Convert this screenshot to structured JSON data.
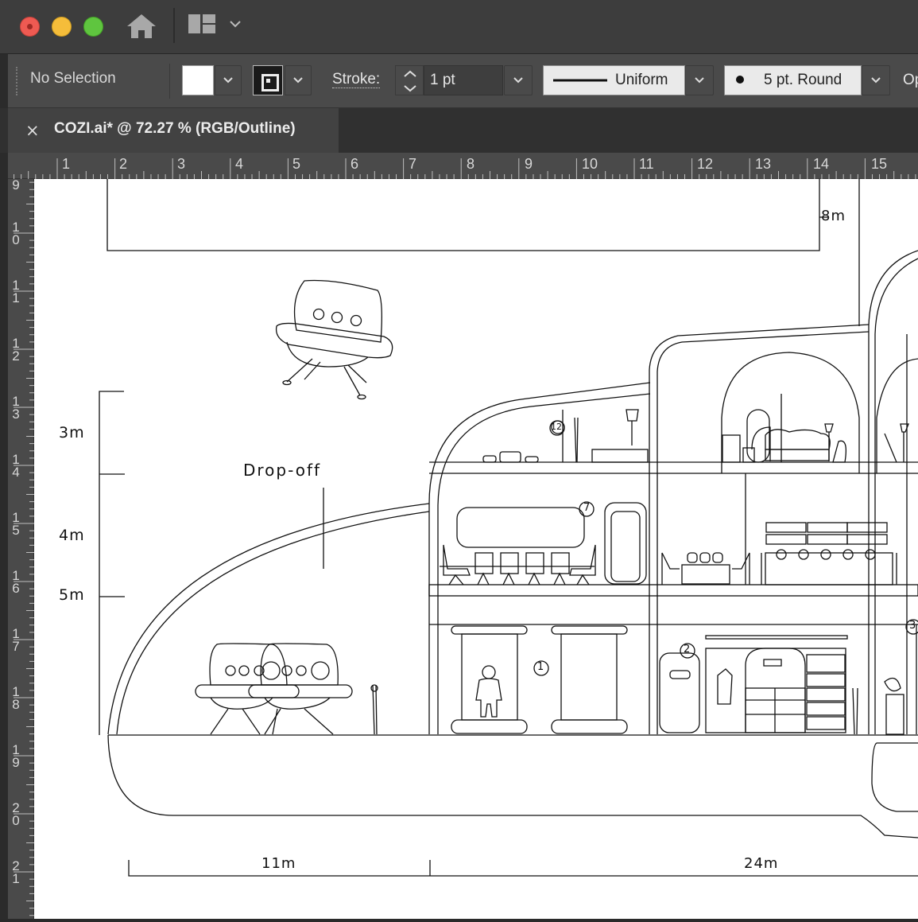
{
  "window": {
    "controls": [
      "close-button",
      "minimize-button",
      "zoom-button"
    ]
  },
  "titlebar": {
    "icons": [
      "home-icon",
      "workspace-layout-icon",
      "chevron-down-icon"
    ]
  },
  "control_bar": {
    "selection_status": "No Selection",
    "stroke_label": "Stroke:",
    "stroke_weight": "1 pt",
    "variable_width_profile": "Uniform",
    "brush_definition": "5 pt. Round",
    "truncated_label": "Op"
  },
  "document_tab": {
    "close_glyph": "×",
    "title": "COZI.ai* @ 72.27 % (RGB/Outline)"
  },
  "rulers": {
    "horizontal": [
      "1",
      "2",
      "3",
      "4",
      "5",
      "6",
      "7",
      "8",
      "9",
      "10",
      "11",
      "12",
      "13",
      "14",
      "15"
    ],
    "vertical": [
      "9",
      "10",
      "11",
      "12",
      "13",
      "14",
      "15",
      "16",
      "17",
      "18",
      "19",
      "20",
      "21"
    ]
  },
  "artwork": {
    "labels": {
      "top_dimension": "8m",
      "height_3": "3m",
      "height_4": "4m",
      "height_5": "5m",
      "drop_off": "Drop-off",
      "width_left": "11m",
      "width_right": "24m"
    },
    "room_markers": [
      "1",
      "2",
      "3",
      "7",
      "12"
    ]
  }
}
